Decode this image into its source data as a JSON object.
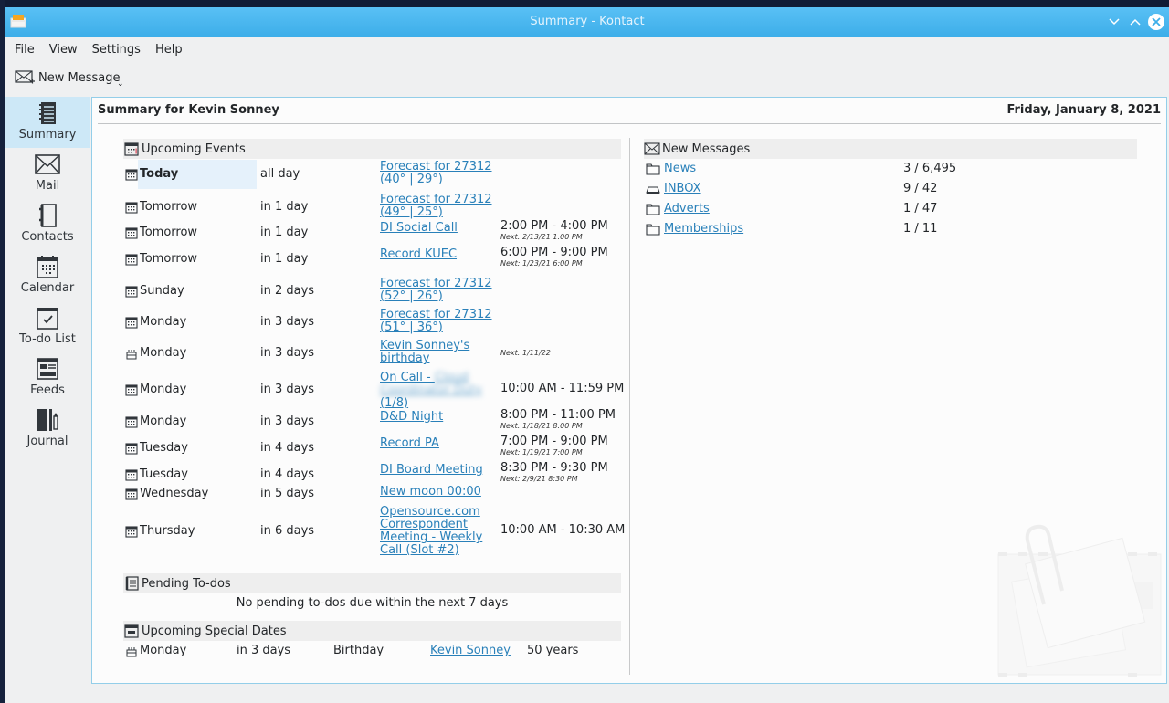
{
  "window": {
    "title": "Summary - Kontact",
    "controls": [
      "minimize",
      "maximize",
      "close"
    ]
  },
  "menubar": {
    "items": [
      "File",
      "View",
      "Settings",
      "Help"
    ]
  },
  "toolbar": {
    "new_message_label": "New Message",
    "new_message_icon": "mail-new-icon",
    "dropdown_icon": "chevron-down-icon"
  },
  "sidebar": {
    "items": [
      {
        "label": "Summary",
        "icon": "summary-notebook-icon",
        "active": true
      },
      {
        "label": "Mail",
        "icon": "envelope-icon",
        "active": false
      },
      {
        "label": "Contacts",
        "icon": "address-book-icon",
        "active": false
      },
      {
        "label": "Calendar",
        "icon": "calendar-icon",
        "active": false
      },
      {
        "label": "To-do List",
        "icon": "todo-checkbox-icon",
        "active": false
      },
      {
        "label": "Feeds",
        "icon": "feeds-newspaper-icon",
        "active": false
      },
      {
        "label": "Journal",
        "icon": "journal-icon",
        "active": false
      }
    ]
  },
  "summary": {
    "title": "Summary for Kevin Sonney",
    "date": "Friday, January 8, 2021"
  },
  "upcoming_events": {
    "header": "Upcoming Events",
    "rows": [
      {
        "icon": "calendar-icon",
        "day": "Today",
        "when": "all day",
        "summary": "Forecast for 27312 (40° | 29°)",
        "time": "",
        "next": ""
      },
      {
        "icon": "calendar-icon",
        "day": "Tomorrow",
        "when": "in 1 day",
        "summary": "Forecast for 27312 (49° | 25°)",
        "time": "",
        "next": ""
      },
      {
        "icon": "calendar-icon",
        "day": "Tomorrow",
        "when": "in 1 day",
        "summary": "DI Social Call",
        "time": "2:00 PM - 4:00 PM",
        "next": "Next: 2/13/21 1:00 PM"
      },
      {
        "icon": "calendar-icon",
        "day": "Tomorrow",
        "when": "in 1 day",
        "summary": "Record KUEC",
        "time": "6:00 PM - 9:00 PM",
        "next": "Next: 1/23/21 6:00 PM"
      },
      {
        "icon": "calendar-icon",
        "day": "Sunday",
        "when": "in 2 days",
        "summary": "Forecast for 27312 (52° | 26°)",
        "time": "",
        "next": ""
      },
      {
        "icon": "calendar-icon",
        "day": "Monday",
        "when": "in 3 days",
        "summary": "Forecast for 27312 (51° | 36°)",
        "time": "",
        "next": ""
      },
      {
        "icon": "birthday-cake-icon",
        "day": "Monday",
        "when": "in 3 days",
        "summary": "Kevin Sonney's birthday",
        "time": "",
        "next": "Next: 1/11/22"
      },
      {
        "icon": "calendar-icon",
        "day": "Monday",
        "when": "in 3 days",
        "summary_pre": "On Call - ",
        "summary_blurred": "Cloud Coordinator Duty",
        "summary_post": "(1/8)",
        "time": "10:00 AM - 11:59 PM",
        "next": ""
      },
      {
        "icon": "calendar-icon",
        "day": "Monday",
        "when": "in 3 days",
        "summary": "D&D Night",
        "time": "8:00 PM - 11:00 PM",
        "next": "Next: 1/18/21 8:00 PM"
      },
      {
        "icon": "calendar-icon",
        "day": "Tuesday",
        "when": "in 4 days",
        "summary": "Record PA",
        "time": "7:00 PM - 9:00 PM",
        "next": "Next: 1/19/21 7:00 PM"
      },
      {
        "icon": "calendar-icon",
        "day": "Tuesday",
        "when": "in 4 days",
        "summary": "DI Board Meeting",
        "time": "8:30 PM - 9:30 PM",
        "next": "Next: 2/9/21 8:30 PM"
      },
      {
        "icon": "calendar-icon",
        "day": "Wednesday",
        "when": "in 5 days",
        "summary": "New moon 00:00",
        "time": "",
        "next": ""
      },
      {
        "icon": "calendar-icon",
        "day": "Thursday",
        "when": "in 6 days",
        "summary": "Opensource.com Correspondent Meeting - Weekly Call (Slot #2)",
        "time": "10:00 AM - 10:30 AM",
        "next": ""
      }
    ]
  },
  "pending_todos": {
    "header": "Pending To-dos",
    "empty_text": "No pending to-dos due within the next 7 days"
  },
  "special_dates": {
    "header": "Upcoming Special Dates",
    "rows": [
      {
        "icon": "birthday-cake-icon",
        "day": "Monday",
        "when": "in 3 days",
        "type": "Birthday",
        "name": "Kevin Sonney",
        "age": "50 years"
      }
    ]
  },
  "new_messages": {
    "header": "New Messages",
    "folders": [
      {
        "icon": "folder-icon",
        "name": "News",
        "count": "3 / 6,495"
      },
      {
        "icon": "inbox-tray-icon",
        "name": "INBOX",
        "count": "9 / 42"
      },
      {
        "icon": "folder-icon",
        "name": "Adverts",
        "count": "1 / 47"
      },
      {
        "icon": "folder-icon",
        "name": "Memberships",
        "count": "1 / 11"
      }
    ]
  },
  "colors": {
    "titlebar": "#3daee9",
    "link": "#2980b9",
    "active_sidebar": "#cde8f7",
    "content_border": "#93cee9"
  }
}
